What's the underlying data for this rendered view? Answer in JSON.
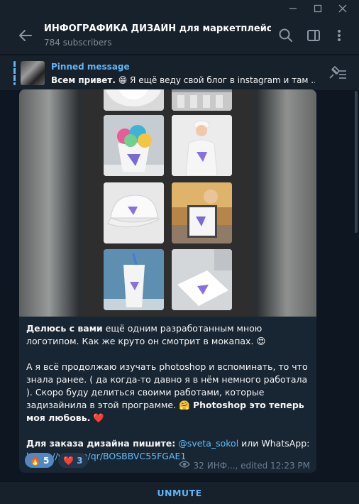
{
  "window": {
    "controls": [
      "minimize",
      "maximize",
      "close"
    ]
  },
  "header": {
    "title": "ИНФОГРАФИКА ДИЗАЙН для маркетплейсов W...",
    "subtitle": "784 subscribers",
    "icons": [
      "back-arrow-icon",
      "search-icon",
      "sidebar-toggle-icon",
      "more-vert-icon"
    ]
  },
  "pinned": {
    "label": "Pinned message",
    "text_bold": "Всем привет.",
    "text_rest": " 😁 Я ещё веду свой блог в instagram и там ...",
    "icon": "unpin-list-icon"
  },
  "message": {
    "line1_bold": "Делюсь с вами",
    "line1_rest": " ещё одним разработанным мною логотипом. Как же круто он смотрит в мокапах. 😍",
    "para2": "А я всё продолжаю изучать photoshop и вспоминать, то что знала ранее. ( да когда-то давно я в нём немного работала ). Скоро буду делиться своими работами, которые задизайнила в этой программе. 🤗",
    "para2_bold": " Photoshop это теперь моя любовь.",
    "para2_emoji": " ❤️",
    "order_bold": "Для заказа дизайна пишите:",
    "order_user": " @sveta_sokol",
    "order_rest": " или WhatsApp:",
    "order_link": "https://wa.me/qr/BOSBBVC55FGAE1",
    "reactions": [
      {
        "emoji": "🔥",
        "count": "5",
        "active": true
      },
      {
        "emoji": "❤️",
        "count": "3",
        "active": false
      }
    ],
    "views": "32",
    "meta_text": "ИНФ..., edited 12:23 PM"
  },
  "footer": {
    "unmute_label": "UNMUTE"
  },
  "colors": {
    "accent": "#5eb5f7",
    "bubble": "#182533",
    "background": "#0e1621",
    "panel": "#17212b"
  }
}
